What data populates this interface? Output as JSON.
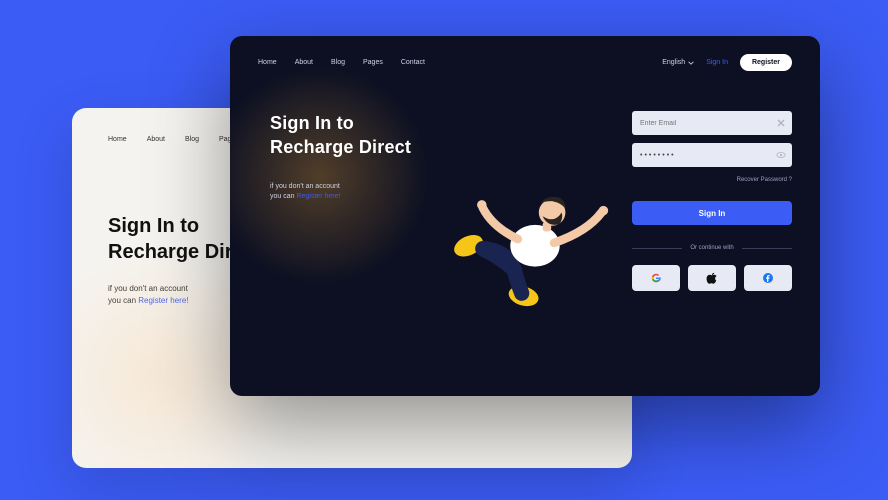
{
  "nav": {
    "home": "Home",
    "about": "About",
    "blog": "Blog",
    "pages": "Pages",
    "contact": "Contact"
  },
  "hero": {
    "title_line1": "Sign In to",
    "title_line2": "Recharge Direct",
    "sub_line1": "if you don't an account",
    "sub_line2_prefix": "you can ",
    "sub_link": "Register here!"
  },
  "header": {
    "language": "English",
    "signin": "Sign In",
    "register": "Register"
  },
  "form": {
    "email_placeholder": "Enter Email",
    "password_value": "••••••••",
    "recover": "Recover Password ?",
    "submit": "Sign In",
    "divider": "Or continue with"
  },
  "social": {
    "google": "google",
    "apple": "apple",
    "facebook": "facebook"
  },
  "colors": {
    "bg": "#3b5cf5",
    "dark_card": "#0d1022",
    "light_card": "#f5f3ef",
    "accent": "#3b5cf5"
  }
}
